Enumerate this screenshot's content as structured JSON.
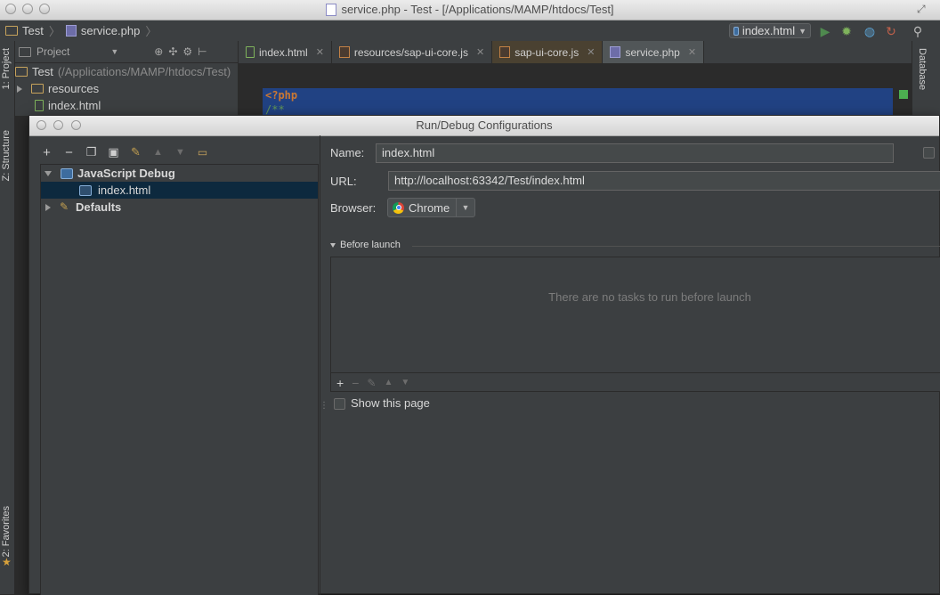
{
  "window": {
    "title": "service.php - Test - [/Applications/MAMP/htdocs/Test]"
  },
  "nav": {
    "breadcrumbs": [
      "Test",
      "service.php"
    ],
    "run_config": "index.html"
  },
  "left_strip": {
    "tabs": [
      "1: Project",
      "Z: Structure",
      "2: Favorites"
    ]
  },
  "right_strip": {
    "tabs": [
      "Database"
    ]
  },
  "project_panel": {
    "selector": "Project",
    "tree": [
      {
        "name": "Test",
        "path": "(/Applications/MAMP/htdocs/Test)"
      },
      {
        "name": "resources"
      },
      {
        "name": "index.html"
      }
    ]
  },
  "editor": {
    "tabs": [
      {
        "label": "index.html",
        "icon": "html-file-icon"
      },
      {
        "label": "resources/sap-ui-core.js",
        "icon": "js-file-icon"
      },
      {
        "label": "sap-ui-core.js",
        "icon": "js-file-icon"
      },
      {
        "label": "service.php",
        "icon": "php-file-icon",
        "active": true
      }
    ],
    "lines": [
      "<?php",
      "/**"
    ]
  },
  "dialog": {
    "title": "Run/Debug Configurations",
    "toolbar": [
      "add",
      "remove",
      "copy",
      "save",
      "edit-defaults",
      "move-up",
      "move-down",
      "folder"
    ],
    "tree": [
      {
        "label": "JavaScript Debug",
        "expanded": true
      },
      {
        "label": "index.html",
        "selected": true
      },
      {
        "label": "Defaults",
        "expanded": false
      }
    ],
    "name_label": "Name:",
    "name_value": "index.html",
    "url_label": "URL:",
    "url_value": "http://localhost:63342/Test/index.html",
    "browser_label": "Browser:",
    "browser_value": "Chrome",
    "before_launch_label": "Before launch",
    "before_launch_empty": "There are no tasks to run before launch",
    "show_page_label": "Show this page"
  },
  "colors": {
    "background": "#2b2b2b",
    "panel": "#3c3f41",
    "selection": "#214283",
    "php_tag": "#cc7832",
    "doc_comment": "#629755"
  }
}
